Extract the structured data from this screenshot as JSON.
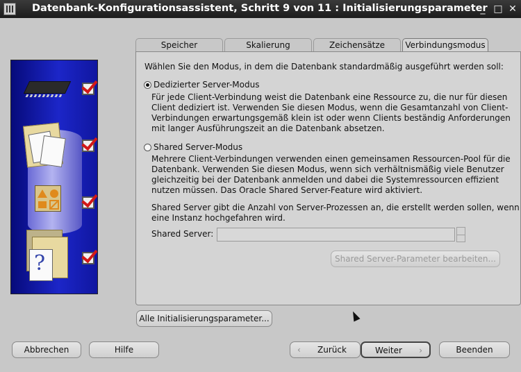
{
  "window": {
    "title": "Datenbank-Konfigurationsassistent, Schritt 9 von 11 : Initialisierungsparameter",
    "minimize_glyph": "_",
    "maximize_glyph": "□",
    "close_glyph": "✕"
  },
  "tabs": [
    {
      "label": "Speicher",
      "active": false
    },
    {
      "label": "Skalierung",
      "active": false
    },
    {
      "label": "Zeichensätze",
      "active": false
    },
    {
      "label": "Verbindungsmodus",
      "active": true
    }
  ],
  "panel": {
    "intro": "Wählen Sie den Modus, in dem die Datenbank standardmäßig ausgeführt werden soll:",
    "dedicated": {
      "label": "Dedizierter Server-Modus",
      "selected": true,
      "description": [
        "Für jede Client-Verbindung weist die Datenbank eine Ressource zu, die nur für diesen",
        "Client dediziert ist. Verwenden Sie diesen Modus, wenn die Gesamtanzahl von Client-",
        "Verbindungen erwartungsgemäß klein ist oder wenn Clients beständig Anforderungen",
        "mit langer Ausführungszeit an die Datenbank absetzen."
      ]
    },
    "shared": {
      "label": "Shared Server-Modus",
      "selected": false,
      "description": [
        "Mehrere Client-Verbindungen verwenden einen gemeinsamen Ressourcen-Pool für die",
        "Datenbank. Verwenden Sie diesen Modus, wenn sich verhältnismäßig viele Benutzer",
        "gleichzeitig bei der Datenbank anmelden und dabei die Systemressourcen effizient",
        "nutzen müssen. Das Oracle Shared Server-Feature wird aktiviert."
      ]
    },
    "shared_note": [
      "Shared Server gibt die Anzahl von Server-Prozessen an, die erstellt werden sollen, wenn",
      "eine Instanz hochgefahren wird."
    ],
    "shared_server_label": "Shared Server:",
    "shared_server_value": "",
    "shared_params_button": "Shared Server-Parameter bearbeiten..."
  },
  "all_params_button": "Alle Initialisierungsparameter...",
  "footer": {
    "cancel": "Abbrechen",
    "help": "Hilfe",
    "back": "Zurück",
    "next": "Weiter",
    "finish": "Beenden"
  },
  "colors": {
    "check_mark": "#d21818",
    "side_panel": "#1c26c8"
  },
  "side_icons": [
    "chip-icon",
    "documents-icon",
    "shapes-icon",
    "help-documents-icon"
  ]
}
